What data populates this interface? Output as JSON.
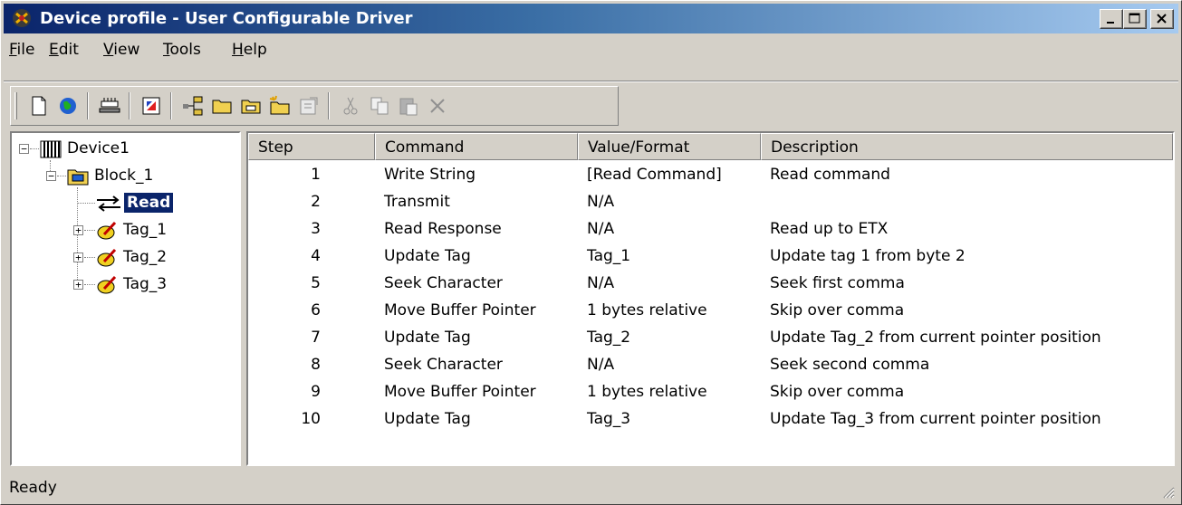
{
  "window": {
    "title": "Device profile - User Configurable Driver",
    "controls": {
      "minimize": "minimize",
      "maximize": "maximize",
      "close": "close"
    }
  },
  "menu": {
    "items": [
      {
        "label": "File",
        "accel": "F"
      },
      {
        "label": "Edit",
        "accel": "E"
      },
      {
        "label": "View",
        "accel": "V"
      },
      {
        "label": "Tools",
        "accel": "T"
      },
      {
        "label": "Help",
        "accel": "H"
      }
    ]
  },
  "toolbar": {
    "buttons": [
      "new-icon",
      "globe-icon",
      "device-icon",
      "record-icon",
      "tree-icon",
      "folder-icon",
      "folder-open-icon",
      "folder-new-icon",
      "properties-icon",
      "cut-icon",
      "copy-icon",
      "paste-icon",
      "delete-icon"
    ]
  },
  "tree": {
    "root": "Device1",
    "block": "Block_1",
    "read": "Read",
    "tags": [
      "Tag_1",
      "Tag_2",
      "Tag_3"
    ]
  },
  "table": {
    "columns": [
      "Step",
      "Command",
      "Value/Format",
      "Description"
    ],
    "rows": [
      {
        "step": "1",
        "command": "Write String",
        "value": "[Read Command]",
        "description": "Read command"
      },
      {
        "step": "2",
        "command": "Transmit",
        "value": "N/A",
        "description": ""
      },
      {
        "step": "3",
        "command": "Read Response",
        "value": "N/A",
        "description": "Read up to ETX"
      },
      {
        "step": "4",
        "command": "Update Tag",
        "value": "Tag_1",
        "description": "Update tag 1 from byte 2"
      },
      {
        "step": "5",
        "command": "Seek Character",
        "value": "N/A",
        "description": "Seek first comma"
      },
      {
        "step": "6",
        "command": "Move Buffer Pointer",
        "value": "1 bytes relative",
        "description": "Skip over comma"
      },
      {
        "step": "7",
        "command": "Update Tag",
        "value": "Tag_2",
        "description": "Update Tag_2 from current pointer position"
      },
      {
        "step": "8",
        "command": "Seek Character",
        "value": "N/A",
        "description": "Seek second comma"
      },
      {
        "step": "9",
        "command": "Move Buffer Pointer",
        "value": "1 bytes relative",
        "description": "Skip over comma"
      },
      {
        "step": "10",
        "command": "Update Tag",
        "value": "Tag_3",
        "description": "Update Tag_3 from current pointer position"
      }
    ]
  },
  "status": {
    "text": "Ready"
  },
  "colors": {
    "title_start": "#0a246a",
    "title_end": "#a6caf0",
    "face": "#d4d0c8",
    "selection": "#0a246a"
  }
}
